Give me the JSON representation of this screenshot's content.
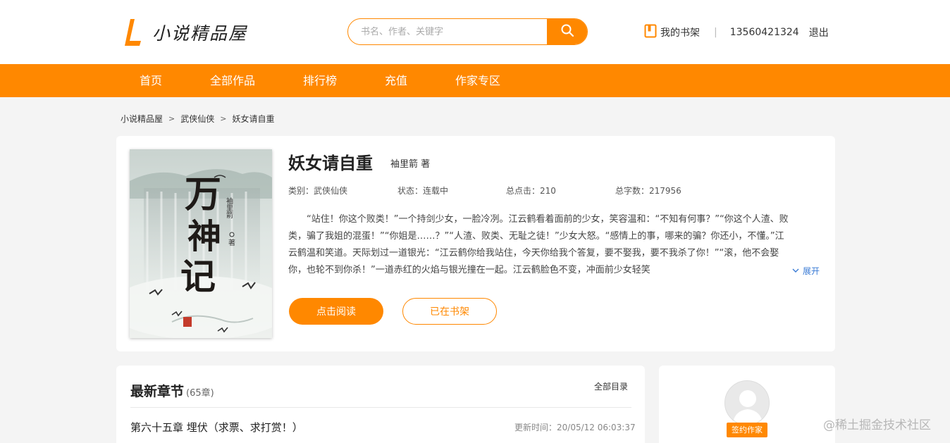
{
  "header": {
    "logo_text": "小说精品屋",
    "search_placeholder": "书名、作者、关键字",
    "my_shelf": "我的书架",
    "separator": "|",
    "phone": "13560421324",
    "logout": "退出"
  },
  "nav": {
    "items": [
      "首页",
      "全部作品",
      "排行榜",
      "充值",
      "作家专区"
    ]
  },
  "breadcrumb": {
    "items": [
      "小说精品屋",
      "武侠仙侠",
      "妖女请自重"
    ],
    "separator": ">"
  },
  "book": {
    "title": "妖女请自重",
    "author": "袖里箭 著",
    "category": "类别：武侠仙侠",
    "status": "状态：连载中",
    "clicks": "总点击：210",
    "words": "总字数：217956",
    "intro": "“站住！你这个败类！”一个持剑少女，一脸冷冽。江云鹤看着面前的少女，笑容温和：“不知有何事？”“你这个人渣、败类，骗了我姐的混蛋！”“你姐是……？”“人渣、败类、无耻之徒！”少女大怒。“感情上的事，哪来的骗？你还小，不懂。”江云鹤温和笑道。天际划过一道银光：“江云鹤你给我站住，今天你给我个答复，要不娶我，要不我杀了你！”“滚，他不会娶你，也轮不到你杀！”一道赤红的火焰与银光撞在一起。江云鹤脸色不变，冲面前少女轻笑",
    "expand": "展开",
    "read_btn": "点击阅读",
    "shelf_btn": "已在书架",
    "cover": {
      "title_chars": [
        "万",
        "神",
        "记"
      ],
      "author_vertical": "袖里箭",
      "zhu": "著"
    }
  },
  "chapters": {
    "title": "最新章节",
    "count": "(65章)",
    "all_link": "全部目录",
    "latest_title": "第六十五章 埋伏（求票、求打赏！）",
    "latest_time": "更新时间：20/05/12 06:03:37"
  },
  "author_panel": {
    "badge": "签约作家"
  },
  "watermark": "@稀土掘金技术社区",
  "colors": {
    "accent": "#ff8800",
    "link": "#3a7bd5",
    "background": "#f4f4f4"
  }
}
